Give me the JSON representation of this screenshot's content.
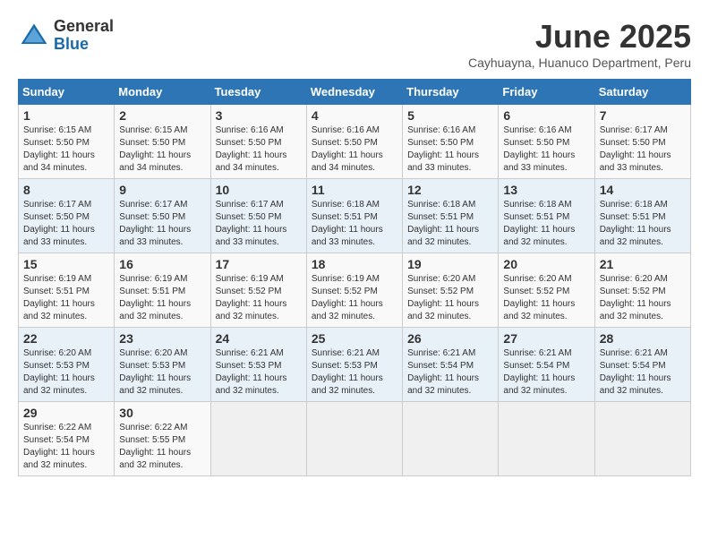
{
  "header": {
    "logo_general": "General",
    "logo_blue": "Blue",
    "month_title": "June 2025",
    "subtitle": "Cayhuayna, Huanuco Department, Peru"
  },
  "calendar": {
    "days_of_week": [
      "Sunday",
      "Monday",
      "Tuesday",
      "Wednesday",
      "Thursday",
      "Friday",
      "Saturday"
    ],
    "weeks": [
      [
        {
          "day": "",
          "empty": true
        },
        {
          "day": "",
          "empty": true
        },
        {
          "day": "",
          "empty": true
        },
        {
          "day": "",
          "empty": true
        },
        {
          "day": "",
          "empty": true
        },
        {
          "day": "",
          "empty": true
        },
        {
          "day": "",
          "empty": true
        }
      ]
    ],
    "cells": [
      {
        "date": "1",
        "sunrise": "6:15 AM",
        "sunset": "5:50 PM",
        "daylight": "11 hours and 34 minutes."
      },
      {
        "date": "2",
        "sunrise": "6:15 AM",
        "sunset": "5:50 PM",
        "daylight": "11 hours and 34 minutes."
      },
      {
        "date": "3",
        "sunrise": "6:16 AM",
        "sunset": "5:50 PM",
        "daylight": "11 hours and 34 minutes."
      },
      {
        "date": "4",
        "sunrise": "6:16 AM",
        "sunset": "5:50 PM",
        "daylight": "11 hours and 34 minutes."
      },
      {
        "date": "5",
        "sunrise": "6:16 AM",
        "sunset": "5:50 PM",
        "daylight": "11 hours and 33 minutes."
      },
      {
        "date": "6",
        "sunrise": "6:16 AM",
        "sunset": "5:50 PM",
        "daylight": "11 hours and 33 minutes."
      },
      {
        "date": "7",
        "sunrise": "6:17 AM",
        "sunset": "5:50 PM",
        "daylight": "11 hours and 33 minutes."
      },
      {
        "date": "8",
        "sunrise": "6:17 AM",
        "sunset": "5:50 PM",
        "daylight": "11 hours and 33 minutes."
      },
      {
        "date": "9",
        "sunrise": "6:17 AM",
        "sunset": "5:50 PM",
        "daylight": "11 hours and 33 minutes."
      },
      {
        "date": "10",
        "sunrise": "6:17 AM",
        "sunset": "5:50 PM",
        "daylight": "11 hours and 33 minutes."
      },
      {
        "date": "11",
        "sunrise": "6:18 AM",
        "sunset": "5:51 PM",
        "daylight": "11 hours and 33 minutes."
      },
      {
        "date": "12",
        "sunrise": "6:18 AM",
        "sunset": "5:51 PM",
        "daylight": "11 hours and 32 minutes."
      },
      {
        "date": "13",
        "sunrise": "6:18 AM",
        "sunset": "5:51 PM",
        "daylight": "11 hours and 32 minutes."
      },
      {
        "date": "14",
        "sunrise": "6:18 AM",
        "sunset": "5:51 PM",
        "daylight": "11 hours and 32 minutes."
      },
      {
        "date": "15",
        "sunrise": "6:19 AM",
        "sunset": "5:51 PM",
        "daylight": "11 hours and 32 minutes."
      },
      {
        "date": "16",
        "sunrise": "6:19 AM",
        "sunset": "5:51 PM",
        "daylight": "11 hours and 32 minutes."
      },
      {
        "date": "17",
        "sunrise": "6:19 AM",
        "sunset": "5:52 PM",
        "daylight": "11 hours and 32 minutes."
      },
      {
        "date": "18",
        "sunrise": "6:19 AM",
        "sunset": "5:52 PM",
        "daylight": "11 hours and 32 minutes."
      },
      {
        "date": "19",
        "sunrise": "6:20 AM",
        "sunset": "5:52 PM",
        "daylight": "11 hours and 32 minutes."
      },
      {
        "date": "20",
        "sunrise": "6:20 AM",
        "sunset": "5:52 PM",
        "daylight": "11 hours and 32 minutes."
      },
      {
        "date": "21",
        "sunrise": "6:20 AM",
        "sunset": "5:52 PM",
        "daylight": "11 hours and 32 minutes."
      },
      {
        "date": "22",
        "sunrise": "6:20 AM",
        "sunset": "5:53 PM",
        "daylight": "11 hours and 32 minutes."
      },
      {
        "date": "23",
        "sunrise": "6:20 AM",
        "sunset": "5:53 PM",
        "daylight": "11 hours and 32 minutes."
      },
      {
        "date": "24",
        "sunrise": "6:21 AM",
        "sunset": "5:53 PM",
        "daylight": "11 hours and 32 minutes."
      },
      {
        "date": "25",
        "sunrise": "6:21 AM",
        "sunset": "5:53 PM",
        "daylight": "11 hours and 32 minutes."
      },
      {
        "date": "26",
        "sunrise": "6:21 AM",
        "sunset": "5:54 PM",
        "daylight": "11 hours and 32 minutes."
      },
      {
        "date": "27",
        "sunrise": "6:21 AM",
        "sunset": "5:54 PM",
        "daylight": "11 hours and 32 minutes."
      },
      {
        "date": "28",
        "sunrise": "6:21 AM",
        "sunset": "5:54 PM",
        "daylight": "11 hours and 32 minutes."
      },
      {
        "date": "29",
        "sunrise": "6:22 AM",
        "sunset": "5:54 PM",
        "daylight": "11 hours and 32 minutes."
      },
      {
        "date": "30",
        "sunrise": "6:22 AM",
        "sunset": "5:55 PM",
        "daylight": "11 hours and 32 minutes."
      }
    ]
  }
}
